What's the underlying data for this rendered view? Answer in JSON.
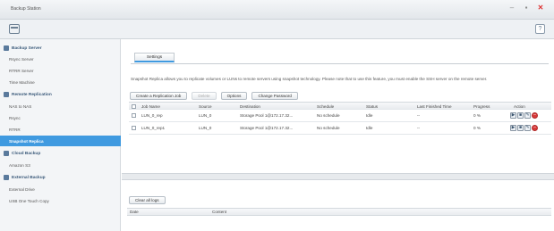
{
  "window": {
    "title": "Backup Station",
    "controls": [
      "–",
      "▪",
      "✕"
    ],
    "help_label": "?"
  },
  "sidebar": {
    "items": [
      {
        "label": "Backup Server",
        "type": "section",
        "icon": "server-icon"
      },
      {
        "label": "Rsync Server",
        "type": "item"
      },
      {
        "label": "RTRR Server",
        "type": "item"
      },
      {
        "label": "Time Machine",
        "type": "item"
      },
      {
        "label": "Remote Replication",
        "type": "section",
        "icon": "replication-icon"
      },
      {
        "label": "NAS to NAS",
        "type": "item"
      },
      {
        "label": "Rsync",
        "type": "item"
      },
      {
        "label": "RTRR",
        "type": "item"
      },
      {
        "label": "Snapshot Replica",
        "type": "item",
        "active": true
      },
      {
        "label": "Cloud Backup",
        "type": "section",
        "icon": "cloud-icon"
      },
      {
        "label": "Amazon S3",
        "type": "item"
      },
      {
        "label": "External Backup",
        "type": "section",
        "icon": "usb-icon"
      },
      {
        "label": "External Drive",
        "type": "item"
      },
      {
        "label": "USB One Touch Copy",
        "type": "item"
      }
    ]
  },
  "main": {
    "tab_label": "Settings",
    "description": "Snapshot Replica allows you to replicate volumes or LUNs to remote servers using snapshot technology. Please note that to use this feature, you must enable the SSH server on the remote server.",
    "buttons": {
      "create": "Create a Replication Job",
      "delete": "Delete",
      "options": "Options",
      "change_password": "Change Password"
    },
    "table": {
      "headers": {
        "job": "Job Name",
        "source": "Source",
        "destination": "Destination",
        "schedule": "Schedule",
        "status": "Status",
        "last": "Last Finished Time",
        "progress": "Progress",
        "action": "Action"
      },
      "rows": [
        {
          "job": "LUN_0_rep",
          "source": "LUN_0",
          "destination": "Storage Pool 1@172.17.32...",
          "schedule": "No schedule",
          "status": "Idle",
          "last": "--",
          "progress": "0 %"
        },
        {
          "job": "LUN_0_rep1",
          "source": "LUN_0",
          "destination": "Storage Pool 1@172.17.32...",
          "schedule": "No schedule",
          "status": "Idle",
          "last": "--",
          "progress": "0 %"
        }
      ]
    }
  },
  "log": {
    "clear_label": "Clear all logs",
    "headers": {
      "date": "Date",
      "content": "Content"
    }
  },
  "colors": {
    "accent": "#3f9ae0",
    "delete": "#d83a3a"
  }
}
